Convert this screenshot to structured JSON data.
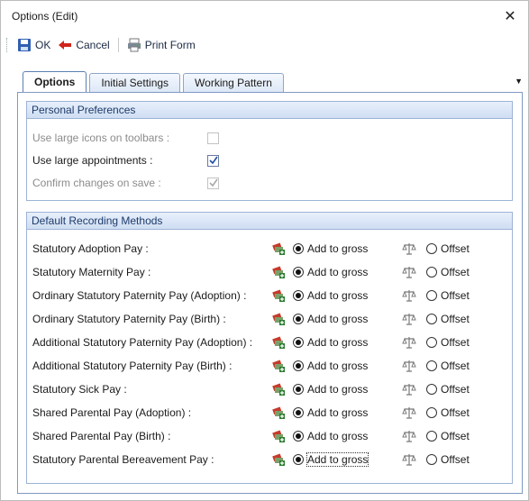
{
  "window": {
    "title": "Options (Edit)",
    "close_glyph": "✕"
  },
  "toolbar": {
    "ok_label": "OK",
    "cancel_label": "Cancel",
    "print_label": "Print Form"
  },
  "tabs": [
    {
      "label": "Options",
      "active": true
    },
    {
      "label": "Initial Settings",
      "active": false
    },
    {
      "label": "Working Pattern",
      "active": false
    }
  ],
  "tab_dropdown_glyph": "▼",
  "personal": {
    "header": "Personal Preferences",
    "items": [
      {
        "label": "Use large icons on toolbars :",
        "checked": false,
        "enabled": false
      },
      {
        "label": "Use large appointments :",
        "checked": true,
        "enabled": true
      },
      {
        "label": "Confirm changes on save :",
        "checked": true,
        "enabled": false
      }
    ]
  },
  "recording": {
    "header": "Default Recording Methods",
    "add_label": "Add to gross",
    "offset_label": "Offset",
    "rows": [
      {
        "label": "Statutory Adoption Pay :",
        "selected": "add"
      },
      {
        "label": "Statutory Maternity Pay :",
        "selected": "add"
      },
      {
        "label": "Ordinary Statutory Paternity Pay (Adoption) :",
        "selected": "add"
      },
      {
        "label": "Ordinary Statutory Paternity Pay (Birth) :",
        "selected": "add"
      },
      {
        "label": "Additional Statutory Paternity Pay (Adoption) :",
        "selected": "add"
      },
      {
        "label": "Additional Statutory Paternity Pay (Birth) :",
        "selected": "add"
      },
      {
        "label": "Statutory Sick Pay :",
        "selected": "add"
      },
      {
        "label": "Shared Parental Pay (Adoption) :",
        "selected": "add"
      },
      {
        "label": "Shared Parental Pay (Birth) :",
        "selected": "add"
      },
      {
        "label": "Statutory Parental Bereavement Pay :",
        "selected": "add"
      }
    ]
  },
  "icons": {
    "save": "floppy-disk-icon",
    "cancel": "back-arrow-icon",
    "print": "print-form-icon",
    "gross": "money-add-icon",
    "offset": "balance-scale-icon"
  },
  "colors": {
    "group_header_text": "#1d3a6a",
    "tab_border": "#5c7fb3",
    "disabled_text": "#8b8b8b",
    "cancel_arrow": "#d0241c"
  }
}
